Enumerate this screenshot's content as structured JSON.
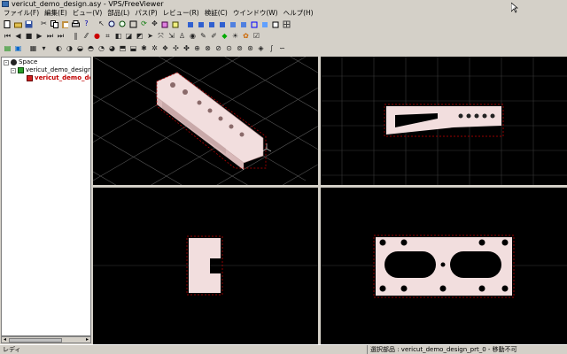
{
  "window": {
    "title": "vericut_demo_design.asy - VPS/FreeViewer"
  },
  "menu": [
    "ファイル(F)",
    "編集(E)",
    "ビュー(V)",
    "部品(L)",
    "パス(P)",
    "レビュー(R)",
    "検証(C)",
    "ウインドウ(W)",
    "ヘルプ(H)"
  ],
  "tree": {
    "root": "Space",
    "assembly": "vericut_demo_design.asy",
    "part": "vericut_demo_design_"
  },
  "status": {
    "left": "レディ",
    "right": "選択部品 : vericut_demo_design_prt_0 - 移動不可"
  },
  "colors": {
    "viewport_bg": "#000000",
    "part_fill": "#f2dede",
    "selection_outline": "#cc0000",
    "grid": "#5a5a5a"
  },
  "icons": {
    "toolbar1": [
      "new-icon",
      "open-icon",
      "save-icon",
      "cut-icon",
      "copy-icon",
      "paste-icon",
      "print-icon",
      "help-icon",
      "pointer-icon",
      "zoom-in-icon",
      "zoom-out-icon",
      "fit-icon",
      "rotate-icon",
      "pan-icon",
      "view-cube-icon",
      "iso-view-icon",
      "front-view-icon",
      "top-view-icon",
      "side-view-icon",
      "wire-icon",
      "shade-icon"
    ],
    "toolbar2": [
      "first-icon",
      "prev-icon",
      "stop-icon",
      "play-icon",
      "next-icon",
      "last-icon",
      "pause-icon",
      "step-icon",
      "record-icon",
      "measure-icon",
      "section-icon",
      "hide-icon",
      "show-icon",
      "color-icon",
      "light-icon",
      "palette-icon",
      "check-icon"
    ]
  }
}
